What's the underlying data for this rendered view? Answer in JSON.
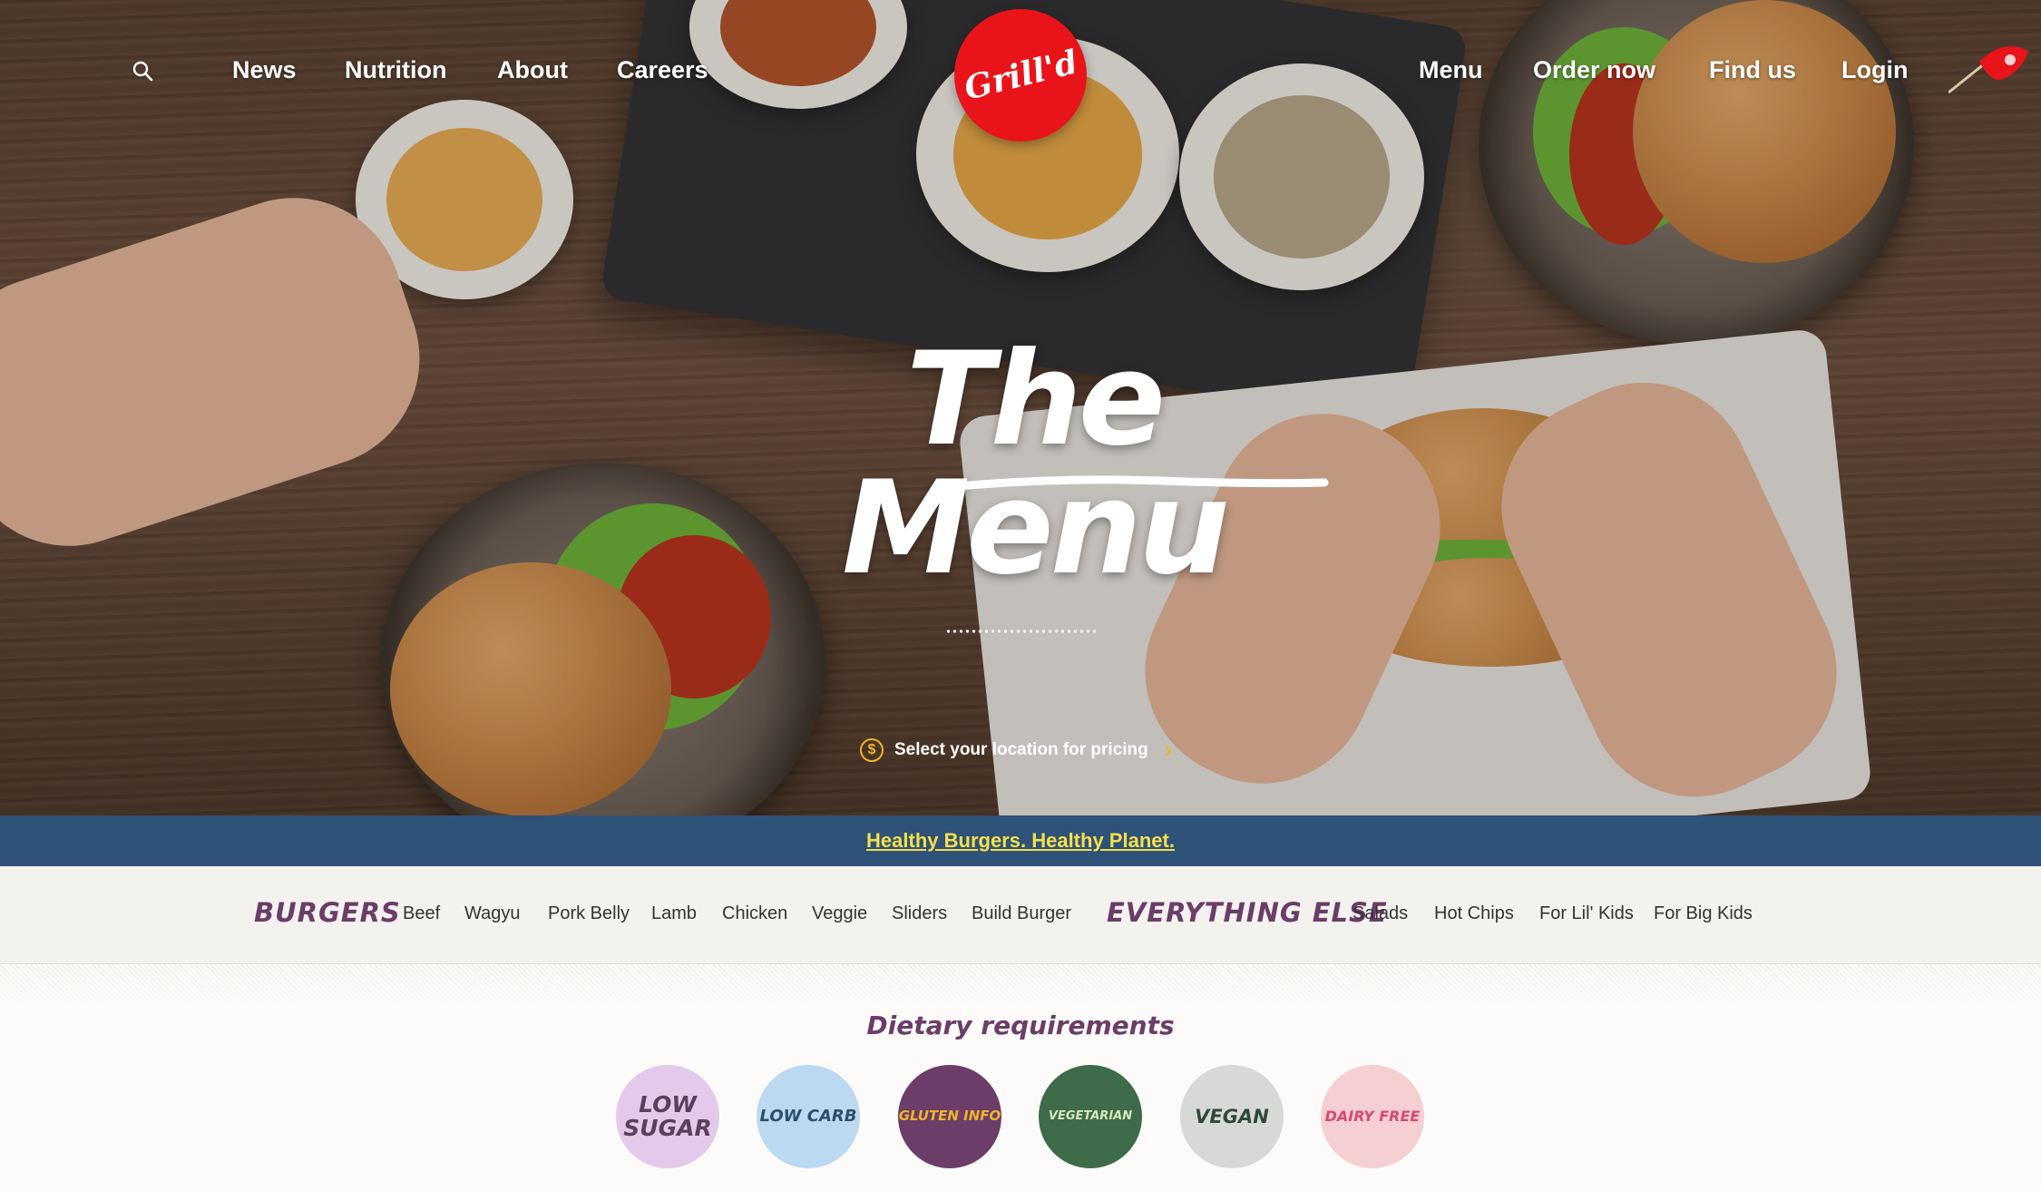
{
  "nav": {
    "left": [
      "News",
      "Nutrition",
      "About",
      "Careers"
    ],
    "right": [
      "Menu",
      "Order now",
      "Find us",
      "Login"
    ],
    "logo_text": "Grill'd"
  },
  "hero": {
    "title": "The Menu",
    "pricing_text": "Select your location for pricing",
    "coin_symbol": "$",
    "chevron": "›"
  },
  "banner": {
    "text": "Healthy Burgers. Healthy Planet."
  },
  "categories": {
    "burgers_heading": "BURGERS",
    "burgers": [
      "Beef",
      "Wagyu",
      "Pork Belly",
      "Lamb",
      "Chicken",
      "Veggie",
      "Sliders",
      "Build Burger"
    ],
    "else_heading": "EVERYTHING ELSE",
    "else": [
      "Salads",
      "Hot Chips",
      "For Lil' Kids",
      "For Big Kids"
    ]
  },
  "dietary": {
    "title": "Dietary requirements",
    "badges": [
      {
        "label": "LOW SUGAR",
        "bg": "#e3c9ea",
        "fg": "#5a3f5e",
        "icon": "smile-icon"
      },
      {
        "label": "LOW CARB",
        "bg": "#bcd9f2",
        "fg": "#2c4e6e",
        "icon": "sun-cloud-icon"
      },
      {
        "label": "GLUTEN INFO",
        "bg": "#6b3d68",
        "fg": "#f0b429",
        "icon": "wheat-icon"
      },
      {
        "label": "VEGETARIAN",
        "bg": "#3e6b4a",
        "fg": "#d9e8b8",
        "icon": "leaf-icon"
      },
      {
        "label": "VEGAN",
        "bg": "#d8d9d6",
        "fg": "#2e4a36",
        "icon": "sprout-icon"
      },
      {
        "label": "DAIRY FREE",
        "bg": "#f6cfd2",
        "fg": "#d94a6e",
        "icon": "milk-carton-icon"
      }
    ]
  },
  "colors": {
    "brand_red": "#e8141a",
    "banner_blue": "#2f5278",
    "banner_text": "#f5e04a",
    "heading_purple": "#6b3d68"
  }
}
